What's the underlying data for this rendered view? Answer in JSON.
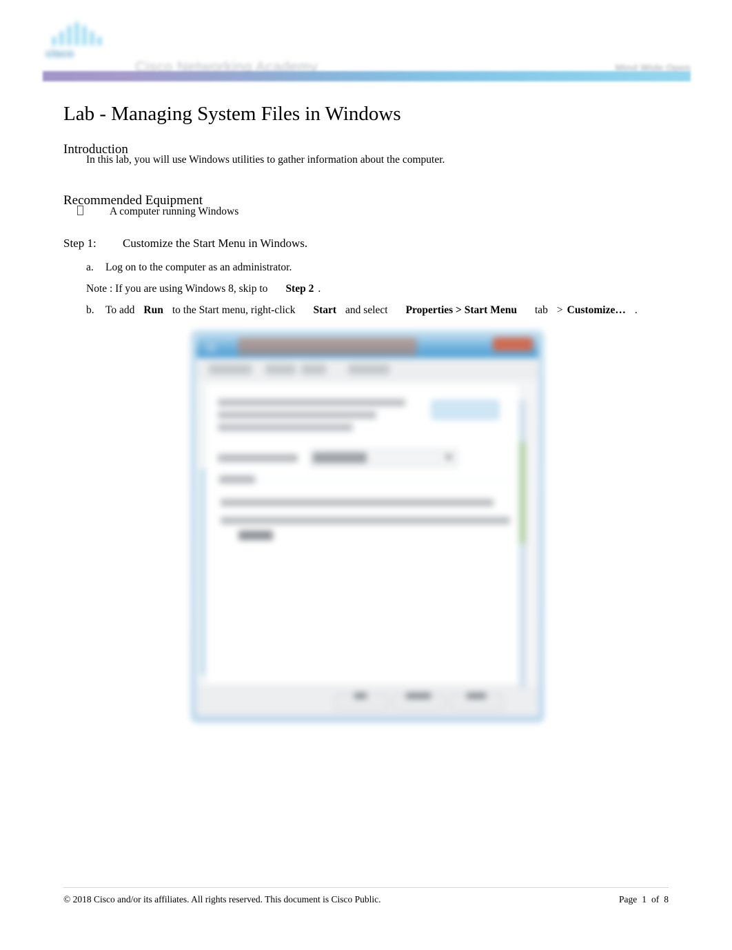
{
  "header": {
    "logo_word": "cisco",
    "logo_icon": "cisco-bridge-logo",
    "academy_title": "Cisco Networking Academy",
    "right_text": "Mind Wide Open"
  },
  "document": {
    "title": "Lab - Managing System Files in Windows",
    "sections": [
      {
        "heading": "Introduction",
        "paragraph": "In this lab, you will use Windows utilities to gather information about the computer."
      },
      {
        "heading": "Recommended Equipment",
        "bullets": [
          {
            "marker": "",
            "text": "A computer running Windows"
          }
        ]
      }
    ],
    "step": {
      "label": "Step 1:",
      "title": "Customize the Start Menu in Windows.",
      "items": [
        {
          "letter": "a.",
          "text": "Log on to the computer as an administrator."
        }
      ],
      "note": {
        "prefix": "Note : If you are using Windows 8, skip to",
        "bold_ref": "Step 2",
        "suffix": "."
      },
      "item_b": {
        "letter": "b.",
        "part1": "To add",
        "bold1": "Run",
        "part2": "to the Start menu, right-click",
        "bold2": "Start",
        "part3": "and select",
        "bold3": "Properties > Start Menu",
        "part4": "tab",
        "part5": ">",
        "bold4": "Customize…",
        "part6": "."
      }
    }
  },
  "screenshot": {
    "name": "taskbar-and-start-menu-properties-dialog",
    "alt": "Blurred Windows Taskbar and Start Menu Properties dialog",
    "title_bar_color": "#4d9fd4",
    "close_button_color": "#cf6b52",
    "customize_button": "Customize",
    "buttons": [
      "OK",
      "Cancel",
      "Apply"
    ],
    "tabs": [
      "Taskbar",
      "Start Menu",
      "Toolbars"
    ],
    "scrollbar_color": "#b4d0a8"
  },
  "footer": {
    "copyright": "© 2018 Cisco and/or its affiliates. All rights reserved. This document is Cisco Public.",
    "page_label": "Page",
    "page_number": "1",
    "page_of": "of",
    "page_total": "8"
  },
  "colors": {
    "rule_gradient_start": "#9b8ec6",
    "rule_gradient_end": "#8ed4ee",
    "header_text": "#b9bcc2",
    "body_text": "#000000"
  }
}
